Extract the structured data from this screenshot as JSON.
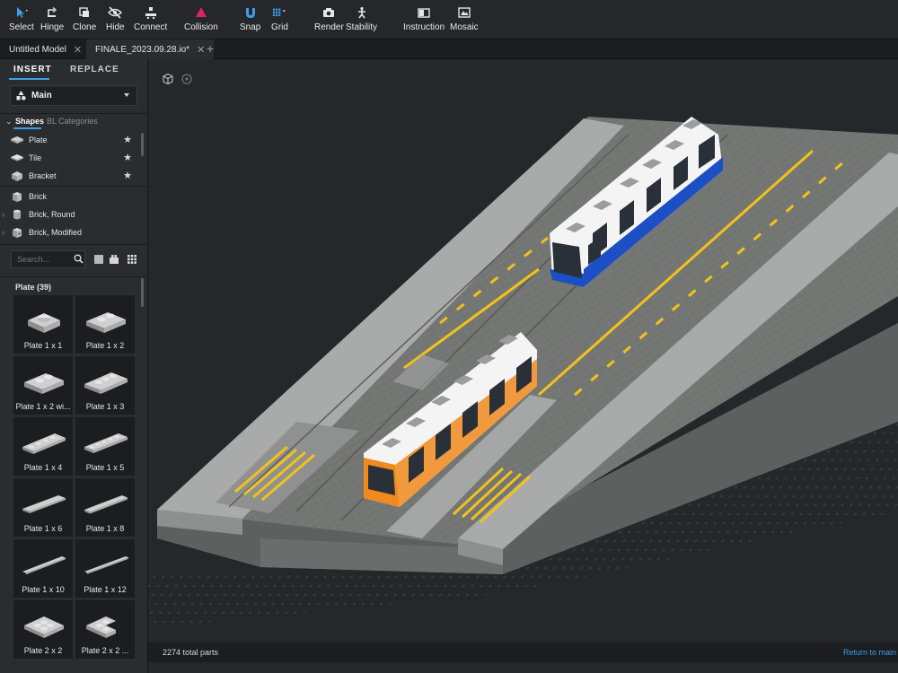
{
  "toolbar": {
    "select": "Select",
    "hinge": "Hinge",
    "clone": "Clone",
    "hide": "Hide",
    "connect": "Connect",
    "collision": "Collision",
    "snap": "Snap",
    "grid": "Grid",
    "render": "Render",
    "stability": "Stability",
    "instruction": "Instruction",
    "mosaic": "Mosaic"
  },
  "tabs": [
    {
      "label": "Untitled Model"
    },
    {
      "label": "FINALE_2023.09.28.io*"
    }
  ],
  "sidebar": {
    "mode_insert": "INSERT",
    "mode_replace": "REPLACE",
    "dropdown_value": "Main",
    "cat_shapes": "Shapes",
    "cat_bl": "BL Categories",
    "shapes": [
      {
        "label": "Plate"
      },
      {
        "label": "Tile"
      },
      {
        "label": "Bracket"
      },
      {
        "label": "Brick"
      },
      {
        "label": "Brick, Round"
      },
      {
        "label": "Brick, Modified"
      }
    ],
    "search_placeholder": "Search...",
    "plate_count": "Plate (39)",
    "parts": [
      {
        "label": "Plate 1 x 1"
      },
      {
        "label": "Plate 1 x 2"
      },
      {
        "label": "Plate 1 x 2 wi..."
      },
      {
        "label": "Plate 1 x 3"
      },
      {
        "label": "Plate 1 x 4"
      },
      {
        "label": "Plate 1 x 5"
      },
      {
        "label": "Plate 1 x 6"
      },
      {
        "label": "Plate 1 x 8"
      },
      {
        "label": "Plate 1 x 10"
      },
      {
        "label": "Plate 1 x 12"
      },
      {
        "label": "Plate 2 x 2"
      },
      {
        "label": "Plate 2 x 2 ..."
      }
    ]
  },
  "status": {
    "parts": "2274 total parts",
    "return": "Return to main"
  },
  "colors": {
    "accent": "#3aa0e8",
    "collision": "#e0245e",
    "tram_front_blue": "#1d4fc4",
    "tram_rear_orange": "#f08a1c",
    "lane_yellow": "#f2c21b"
  }
}
